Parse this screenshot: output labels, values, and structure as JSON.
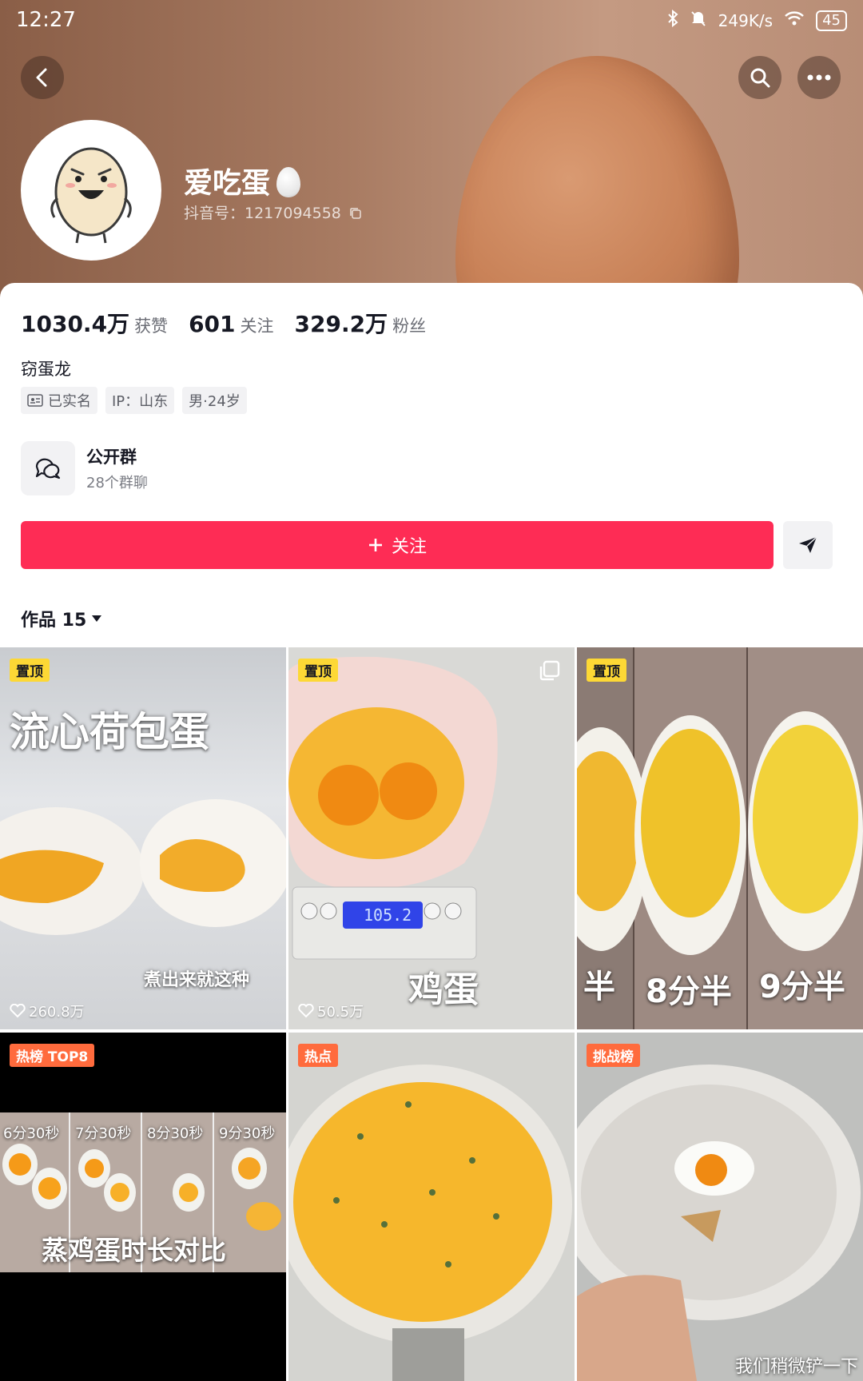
{
  "status_bar": {
    "time": "12:27",
    "network_speed": "249K/s",
    "battery": "45"
  },
  "icons": {
    "back": "chevron-left-icon",
    "search": "search-icon",
    "more": "more-horizontal-icon"
  },
  "profile": {
    "name": "爱吃蛋",
    "douyin_id": "抖音号：1217094558",
    "stats": [
      {
        "value": "1030.4万",
        "label": "获赞"
      },
      {
        "value": "601",
        "label": "关注"
      },
      {
        "value": "329.2万",
        "label": "粉丝"
      }
    ],
    "bio": "窃蛋龙",
    "tags": [
      "已实名",
      "IP：山东",
      "男·24岁"
    ]
  },
  "group": {
    "title": "公开群",
    "subtitle": "28个群聊"
  },
  "actions": {
    "follow_label": "关注"
  },
  "works_tab": {
    "label": "作品 15"
  },
  "videos": [
    {
      "badge": "置顶",
      "likes": "260.8万",
      "title": "流心荷包蛋",
      "subtitle": "煮出来就这种"
    },
    {
      "badge": "置顶",
      "likes": "50.5万",
      "scale_reading": "105.2",
      "caption": "鸡蛋"
    },
    {
      "badge": "置顶",
      "captions": [
        "半",
        "8分半",
        "9分半"
      ]
    },
    {
      "badge": "热榜 TOP8",
      "time_labels": [
        "6分30秒",
        "7分30秒",
        "8分30秒",
        "9分30秒"
      ],
      "caption": "蒸鸡蛋时长对比"
    },
    {
      "badge": "热点"
    },
    {
      "badge": "挑战榜",
      "caption": "我们稍微铲一下"
    }
  ],
  "colors": {
    "accent": "#fe2c55",
    "pin_badge": "#fdd835",
    "hot_badge": "#ff6b3d"
  }
}
